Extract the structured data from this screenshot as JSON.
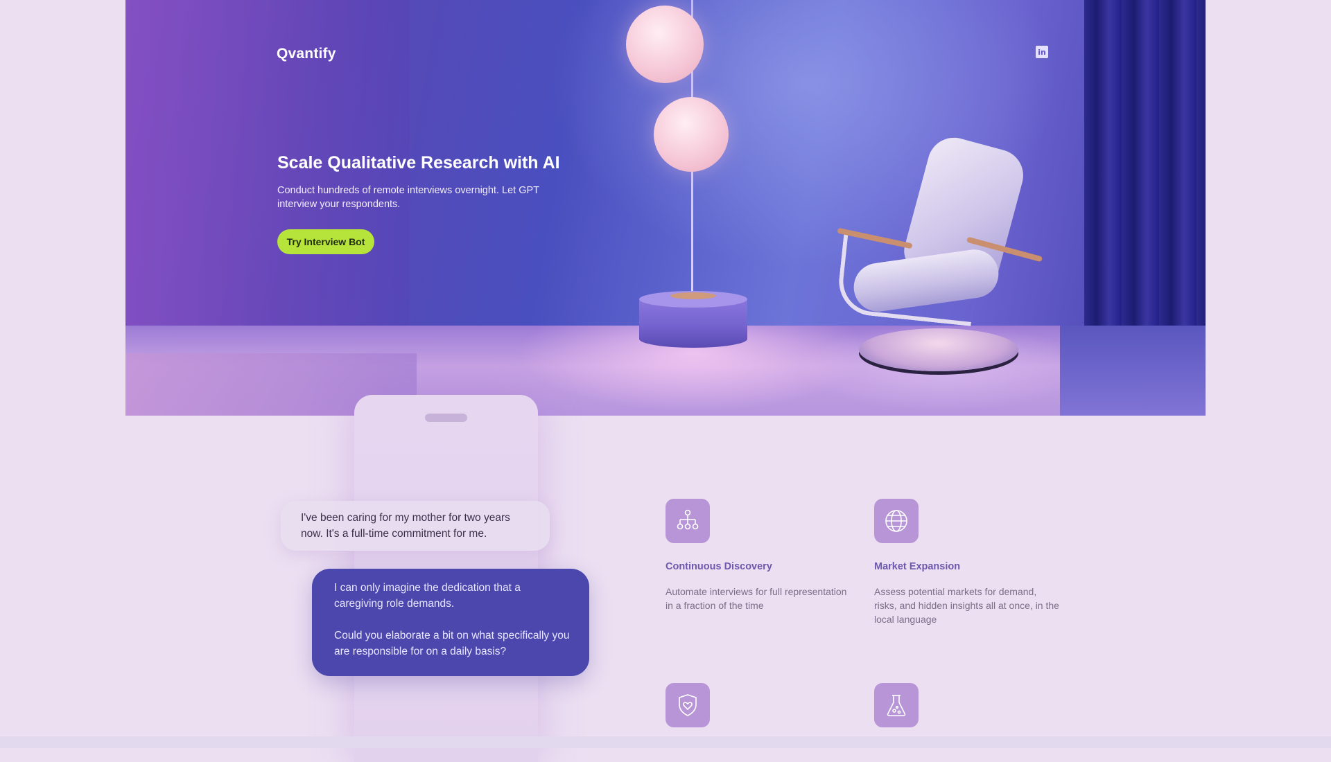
{
  "brand": "Qvantify",
  "hero": {
    "title": "Scale Qualitative Research with AI",
    "subtitle": "Conduct hundreds of remote interviews overnight. Let GPT interview your respondents.",
    "cta_label": "Try Interview Bot"
  },
  "social": {
    "linkedin_glyph": "in"
  },
  "chat": {
    "user_message": "I've been caring for my mother for two years now. It's a full-time commitment for me.",
    "bot_message_1": "I can only imagine the dedication that a caregiving role demands.",
    "bot_message_2": "Could you elaborate a bit on what specifically you are responsible for on a daily basis?"
  },
  "features": [
    {
      "title": "Continuous Discovery",
      "description": "Automate interviews for full representation in a fraction of the time",
      "icon": "org-chart-icon"
    },
    {
      "title": "Market Expansion",
      "description": "Assess potential markets for demand, risks, and hidden insights all at once, in the local language",
      "icon": "globe-icon"
    },
    {
      "title": "",
      "description": "",
      "icon": "shield-heart-icon"
    },
    {
      "title": "",
      "description": "",
      "icon": "flask-icon"
    }
  ],
  "colors": {
    "page_background": "#ecdff2",
    "cta_background": "#b6e43a",
    "bot_bubble": "#4b47ad",
    "feature_icon_tile": "#b795d6",
    "feature_title": "#6c59ad"
  }
}
